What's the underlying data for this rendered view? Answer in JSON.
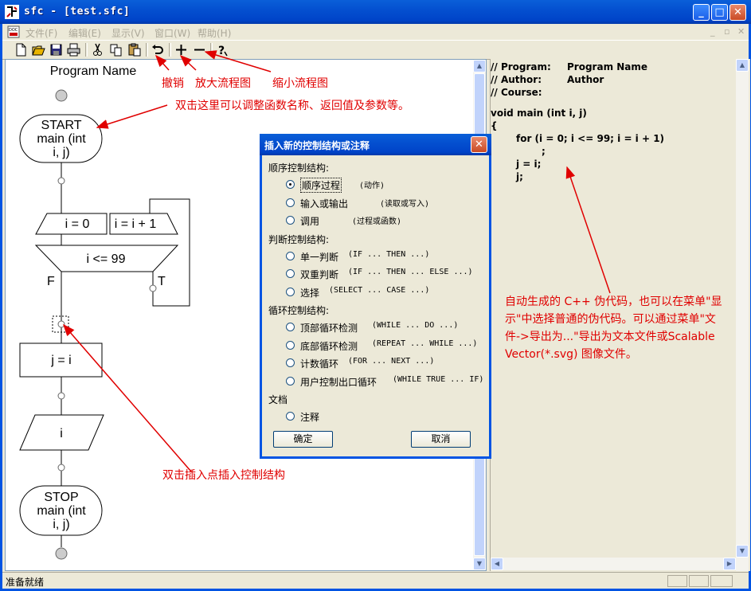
{
  "window": {
    "title": "sfc - [test.sfc]"
  },
  "menus": [
    "文件(F)",
    "编辑(E)",
    "显示(V)",
    "窗口(W)",
    "帮助(H)"
  ],
  "toolbar_icons": [
    "new-icon",
    "open-icon",
    "save-icon",
    "print-icon",
    "cut-icon",
    "copy-icon",
    "paste-icon",
    "undo-icon",
    "zoom-in-icon",
    "zoom-out-icon",
    "help-icon"
  ],
  "flowchart": {
    "program_name": "Program Name",
    "start": [
      "START",
      "main (int",
      "i, j)"
    ],
    "init": "i = 0",
    "step": "i = i + 1",
    "cond": "i <= 99",
    "false_label": "F",
    "true_label": "T",
    "assign": "j = i",
    "io": "i",
    "stop": [
      "STOP",
      "main (int",
      "i, j)"
    ]
  },
  "code": [
    {
      "text": "// Program:",
      "indent": 0
    },
    {
      "text": "Program Name",
      "indent": 0
    },
    {
      "text": "// Author:",
      "indent": 0
    },
    {
      "text": "Author",
      "indent": 0
    },
    {
      "text": "// Course:",
      "indent": 0
    },
    {
      "text": "void main (int i, j)",
      "indent": 0
    },
    {
      "text": "{",
      "indent": 0
    },
    {
      "text": "for (i = 0; i <= 99; i = i + 1)",
      "indent": 1
    },
    {
      "text": ";",
      "indent": 2
    },
    {
      "text": "j = i;",
      "indent": 1
    },
    {
      "text": "j;",
      "indent": 1
    }
  ],
  "annotations": {
    "undo": "撤销",
    "zoom_in": "放大流程图",
    "zoom_out": "缩小流程图",
    "double_click_func": "双击这里可以调整函数名称、返回值及参数等。",
    "insert_point": "双击插入点插入控制结构",
    "pseudo_code": "自动生成的 C++ 伪代码，也可以在菜单\"显示\"中选择普通的伪代码。可以通过菜单\"文件->导出为...\"导出为文本文件或Scalable Vector(*.svg) 图像文件。"
  },
  "dialog": {
    "title": "插入新的控制结构或注释",
    "groups": [
      {
        "label": "顺序控制结构:",
        "options": [
          {
            "label": "顺序过程",
            "hint": "(动作)",
            "selected": true
          },
          {
            "label": "输入或输出",
            "hint": "(读取或写入)",
            "selected": false
          },
          {
            "label": "调用",
            "hint": "(过程或函数)",
            "selected": false
          }
        ]
      },
      {
        "label": "判断控制结构:",
        "options": [
          {
            "label": "单一判断",
            "hint": "(IF ... THEN ...)",
            "selected": false
          },
          {
            "label": "双重判断",
            "hint": "(IF ... THEN ... ELSE ...)",
            "selected": false
          },
          {
            "label": "选择",
            "hint": "(SELECT ... CASE ...)",
            "selected": false
          }
        ]
      },
      {
        "label": "循环控制结构:",
        "options": [
          {
            "label": "顶部循环检测",
            "hint": "(WHILE ... DO ...)",
            "selected": false
          },
          {
            "label": "底部循环检测",
            "hint": "(REPEAT ... WHILE ...)",
            "selected": false
          },
          {
            "label": "计数循环",
            "hint": "(FOR ... NEXT ...)",
            "selected": false
          },
          {
            "label": "用户控制出口循环",
            "hint": "(WHILE TRUE ... IF)",
            "selected": false
          }
        ]
      },
      {
        "label": "文档",
        "options": [
          {
            "label": "注释",
            "hint": "",
            "selected": false
          }
        ]
      }
    ],
    "ok": "确定",
    "cancel": "取消"
  },
  "status": {
    "text": "准备就绪"
  },
  "colors": {
    "annotation": "#e00000",
    "titlebar": "#0450d0"
  }
}
